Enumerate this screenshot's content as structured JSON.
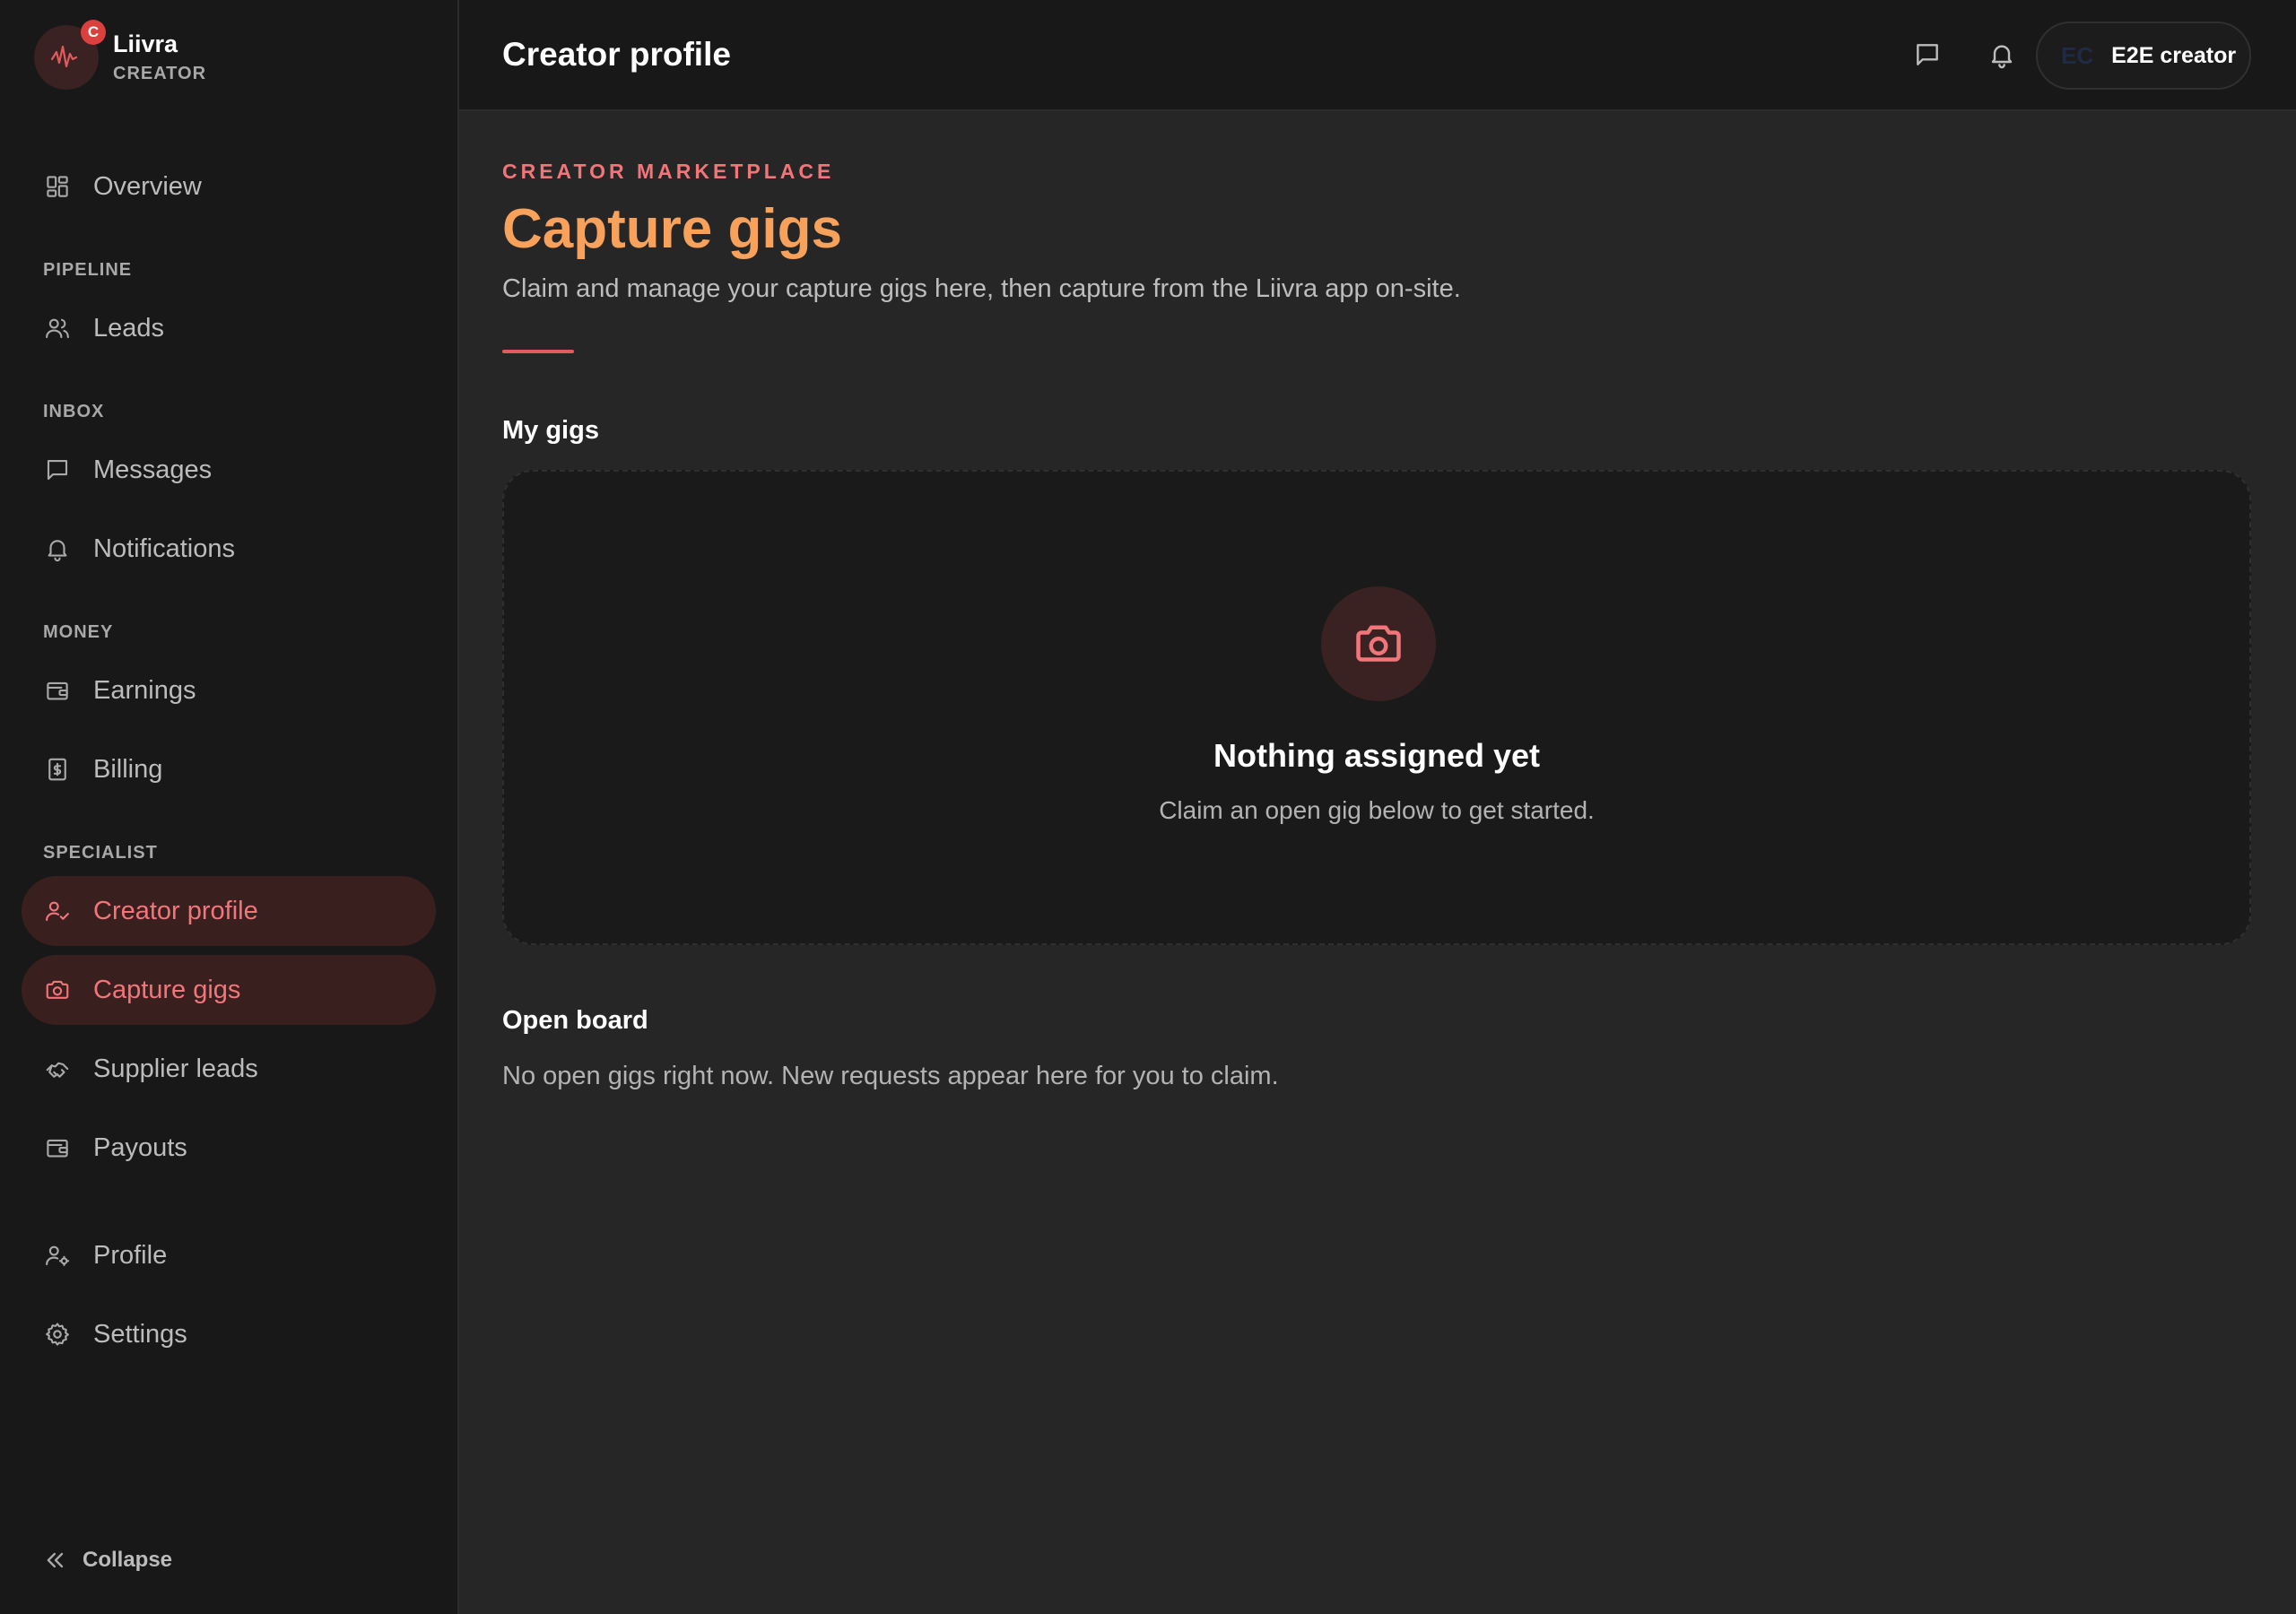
{
  "brand": {
    "name": "Liivra",
    "role": "CREATOR",
    "badge": "C"
  },
  "sidebar": {
    "items": [
      {
        "key": "overview",
        "label": "Overview",
        "icon": "layout-grid-icon"
      },
      {
        "section": "PIPELINE"
      },
      {
        "key": "leads",
        "label": "Leads",
        "icon": "users-icon"
      },
      {
        "section": "INBOX"
      },
      {
        "key": "messages",
        "label": "Messages",
        "icon": "message-icon"
      },
      {
        "key": "notifications",
        "label": "Notifications",
        "icon": "bell-icon"
      },
      {
        "section": "MONEY"
      },
      {
        "key": "earnings",
        "label": "Earnings",
        "icon": "wallet-icon"
      },
      {
        "key": "billing",
        "label": "Billing",
        "icon": "receipt-icon"
      },
      {
        "section": "SPECIALIST"
      },
      {
        "key": "creator-profile",
        "label": "Creator profile",
        "icon": "user-check-icon",
        "active": true
      },
      {
        "key": "capture-gigs",
        "label": "Capture gigs",
        "icon": "camera-icon",
        "active": true
      },
      {
        "key": "supplier-leads",
        "label": "Supplier leads",
        "icon": "handshake-icon"
      },
      {
        "key": "payouts",
        "label": "Payouts",
        "icon": "wallet-icon"
      },
      {
        "key": "profile",
        "label": "Profile",
        "icon": "user-cog-icon"
      },
      {
        "key": "settings",
        "label": "Settings",
        "icon": "gear-icon"
      }
    ],
    "collapse_label": "Collapse"
  },
  "header": {
    "title": "Creator profile",
    "user": {
      "initials": "EC",
      "name": "E2E creator"
    }
  },
  "main": {
    "eyebrow": "CREATOR MARKETPLACE",
    "title": "Capture gigs",
    "subtitle": "Claim and manage your capture gigs here, then capture from the Liivra app on-site.",
    "my_gigs": {
      "heading": "My gigs",
      "empty_title": "Nothing assigned yet",
      "empty_subtitle": "Claim an open gig below to get started."
    },
    "open_board": {
      "heading": "Open board",
      "empty_text": "No open gigs right now. New requests appear here for you to claim."
    }
  },
  "colors": {
    "accent": "#f2757a",
    "title_orange": "#f7a15a",
    "sidebar_bg": "#181818",
    "main_bg": "#262626",
    "active_bg": "#3a1f1f"
  }
}
